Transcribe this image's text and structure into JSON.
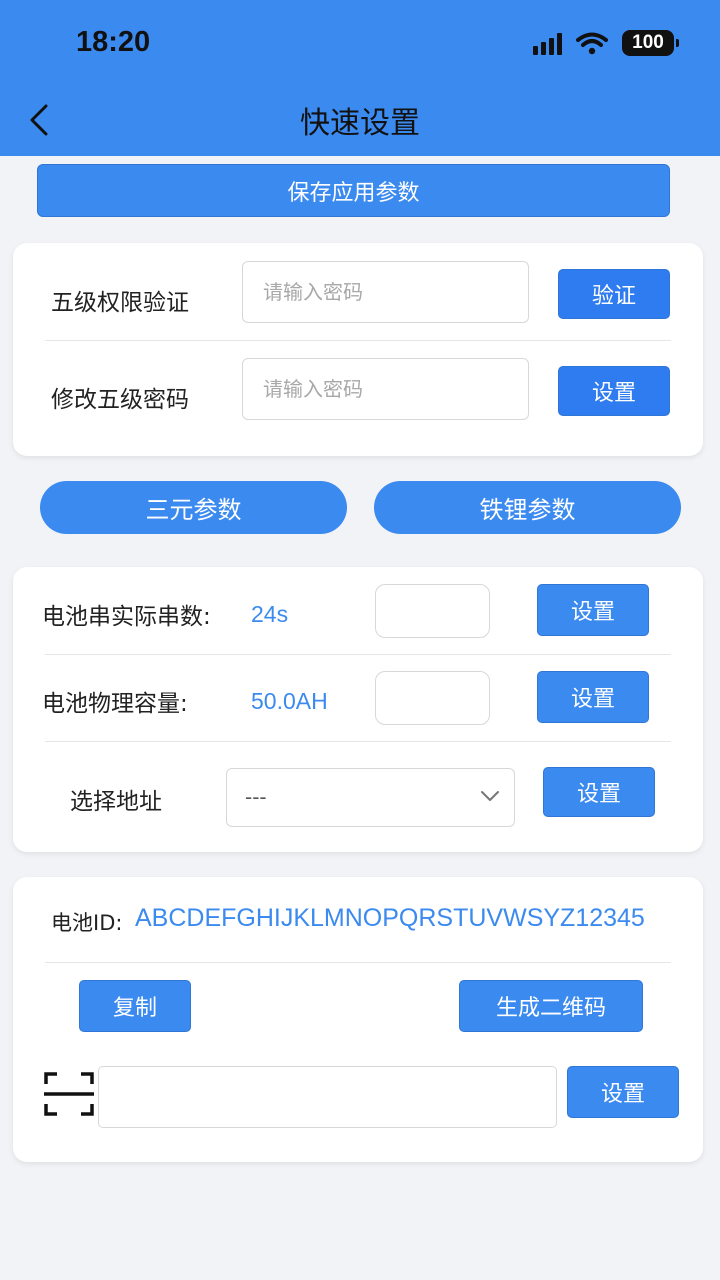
{
  "status_bar": {
    "time": "18:20",
    "battery": "100"
  },
  "header": {
    "title": "快速设置"
  },
  "save_button": "保存应用参数",
  "password_card": {
    "verify": {
      "label": "五级权限验证",
      "placeholder": "请输入密码",
      "button": "验证"
    },
    "change": {
      "label": "修改五级密码",
      "placeholder": "请输入密码",
      "button": "设置"
    }
  },
  "preset_buttons": {
    "ternary": "三元参数",
    "lfp": "铁锂参数"
  },
  "battery_card": {
    "series": {
      "label": "电池串实际串数:",
      "value": "24s",
      "button": "设置"
    },
    "capacity": {
      "label": "电池物理容量:",
      "value": "50.0AH",
      "button": "设置"
    },
    "address": {
      "label": "选择地址",
      "selected": "---",
      "button": "设置"
    }
  },
  "id_card": {
    "id_label": "电池ID:",
    "id_value": "ABCDEFGHIJKLMNOPQRSTUVWSYZ12345",
    "copy_button": "复制",
    "qr_button": "生成二维码",
    "set_button": "设置"
  },
  "colors": {
    "primary": "#3b8af0",
    "background": "#f2f3f7"
  },
  "icons": {
    "back": "chevron-left-icon",
    "scan": "scan-icon",
    "dropdown": "chevron-down-icon"
  }
}
